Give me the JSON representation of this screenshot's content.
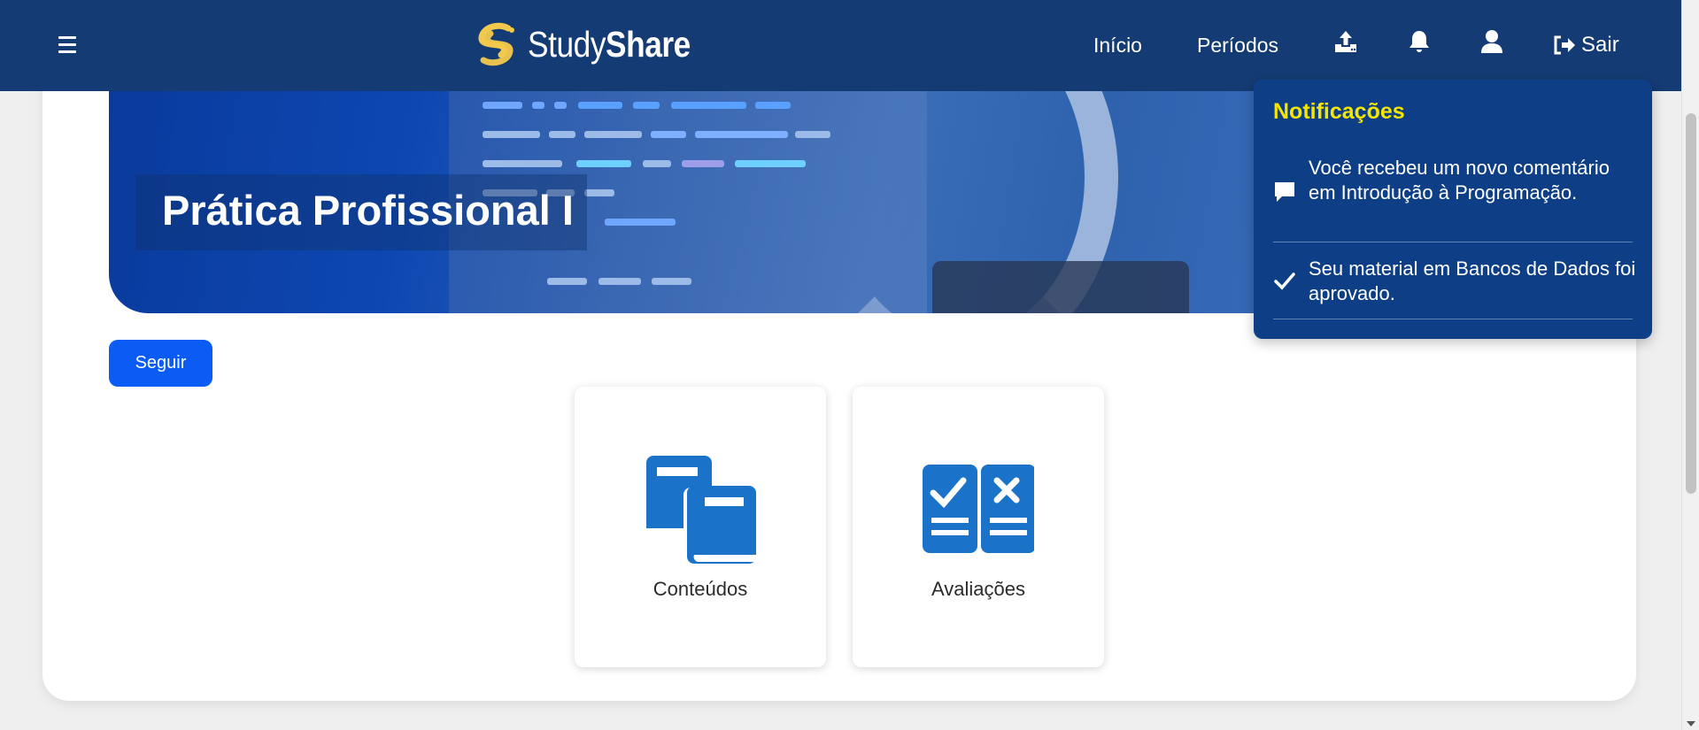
{
  "navbar": {
    "brand": {
      "part1": "Study",
      "part2": "Share"
    },
    "links": {
      "home": "Início",
      "periods": "Períodos"
    },
    "logout": "Sair",
    "icons": {
      "menu": "hamburger-icon",
      "upload": "upload-icon",
      "notifications": "bell-icon",
      "profile": "user-icon",
      "logout": "sign-out-icon"
    }
  },
  "hero": {
    "title": "Prática Profissional I"
  },
  "actions": {
    "follow": "Seguir"
  },
  "tiles": [
    {
      "label": "Conteúdos",
      "icon": "books-icon"
    },
    {
      "label": "Avaliações",
      "icon": "assessment-icon"
    }
  ],
  "notifications": {
    "title": "Notificações",
    "items": [
      {
        "text": "Você recebeu um novo comentário em Introdução à Programação.",
        "icon": "comment-icon"
      },
      {
        "text": "Seu material em Bancos de Dados foi aprovado.",
        "icon": "check-icon"
      }
    ]
  },
  "colors": {
    "navbar": "#143b73",
    "accent": "#0b5cf5",
    "notif_title": "#f5e600",
    "icon_blue": "#1a73c8"
  }
}
